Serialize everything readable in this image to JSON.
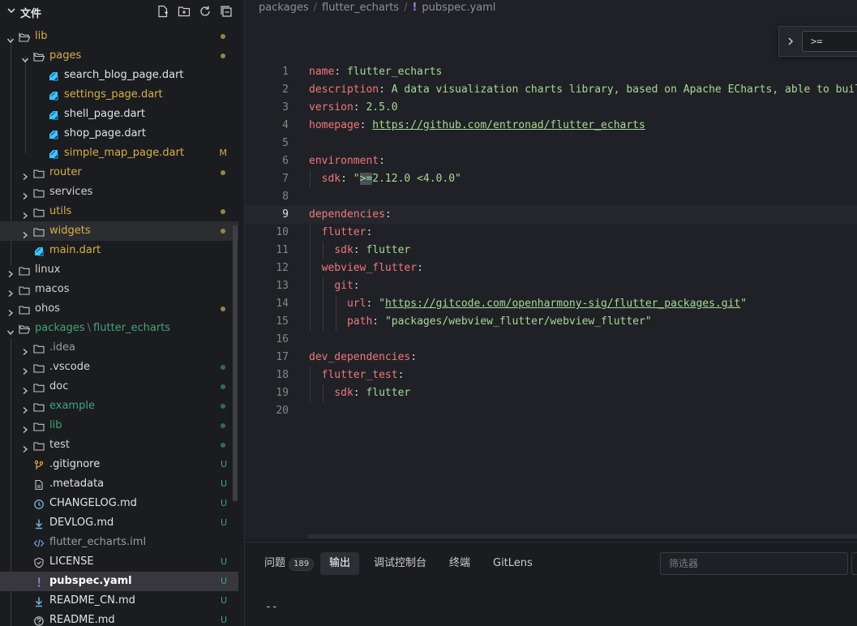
{
  "explorer": {
    "title": "文件",
    "actions": [
      "new-file-icon",
      "new-folder-icon",
      "refresh-icon",
      "collapse-all-icon"
    ],
    "items": [
      {
        "label": "lib",
        "type": "folder",
        "open": true,
        "depth": 0,
        "color": "mod",
        "status": "dot-mod"
      },
      {
        "label": "pages",
        "type": "folder",
        "open": true,
        "depth": 1,
        "color": "mod",
        "status": "dot-mod"
      },
      {
        "label": "search_blog_page.dart",
        "type": "dart",
        "depth": 2,
        "color": "plain",
        "status": ""
      },
      {
        "label": "settings_page.dart",
        "type": "dart",
        "depth": 2,
        "color": "mod",
        "status": ""
      },
      {
        "label": "shell_page.dart",
        "type": "dart",
        "depth": 2,
        "color": "plain",
        "status": ""
      },
      {
        "label": "shop_page.dart",
        "type": "dart",
        "depth": 2,
        "color": "plain",
        "status": ""
      },
      {
        "label": "simple_map_page.dart",
        "type": "dart",
        "depth": 2,
        "color": "mod",
        "status": "M"
      },
      {
        "label": "router",
        "type": "folder",
        "open": false,
        "depth": 1,
        "color": "mod",
        "status": "dot-mod"
      },
      {
        "label": "services",
        "type": "folder",
        "open": false,
        "depth": 1,
        "color": "folder",
        "status": ""
      },
      {
        "label": "utils",
        "type": "folder",
        "open": false,
        "depth": 1,
        "color": "mod",
        "status": "dot-mod"
      },
      {
        "label": "widgets",
        "type": "folder",
        "open": false,
        "depth": 1,
        "color": "mod",
        "status": "dot-mod"
      },
      {
        "label": "main.dart",
        "type": "dart",
        "depth": 1,
        "color": "mod",
        "status": ""
      },
      {
        "label": "linux",
        "type": "folder",
        "open": false,
        "depth": 0,
        "color": "folder",
        "status": ""
      },
      {
        "label": "macos",
        "type": "folder",
        "open": false,
        "depth": 0,
        "color": "folder",
        "status": ""
      },
      {
        "label": "ohos",
        "type": "folder",
        "open": false,
        "depth": 0,
        "color": "folder",
        "status": "dot-mod"
      },
      {
        "label": "packages",
        "label2": "flutter_echarts",
        "type": "folder",
        "open": true,
        "depth": 0,
        "color": "untracked",
        "status": ""
      },
      {
        "label": ".idea",
        "type": "folder",
        "open": false,
        "depth": 1,
        "color": "dim",
        "status": ""
      },
      {
        "label": ".vscode",
        "type": "folder",
        "open": false,
        "depth": 1,
        "color": "folder",
        "status": "dot-untracked"
      },
      {
        "label": "doc",
        "type": "folder",
        "open": false,
        "depth": 1,
        "color": "folder",
        "status": "dot-untracked"
      },
      {
        "label": "example",
        "type": "folder",
        "open": false,
        "depth": 1,
        "color": "untracked",
        "status": "dot-untracked"
      },
      {
        "label": "lib",
        "type": "folder",
        "open": false,
        "depth": 1,
        "color": "untracked",
        "status": "dot-untracked"
      },
      {
        "label": "test",
        "type": "folder",
        "open": false,
        "depth": 1,
        "color": "folder",
        "status": "dot-untracked"
      },
      {
        "label": ".gitignore",
        "type": "git",
        "depth": 1,
        "color": "plain",
        "status": "U"
      },
      {
        "label": ".metadata",
        "type": "file",
        "depth": 1,
        "color": "plain",
        "status": "U"
      },
      {
        "label": "CHANGELOG.md",
        "type": "changelog",
        "depth": 1,
        "color": "plain",
        "status": "U"
      },
      {
        "label": "DEVLOG.md",
        "type": "markdown",
        "depth": 1,
        "color": "plain",
        "status": "U"
      },
      {
        "label": "flutter_echarts.iml",
        "type": "code",
        "depth": 1,
        "color": "dim",
        "status": ""
      },
      {
        "label": "LICENSE",
        "type": "license",
        "depth": 1,
        "color": "plain",
        "status": "U"
      },
      {
        "label": "pubspec.yaml",
        "type": "yaml",
        "depth": 1,
        "color": "plain",
        "status": "U",
        "bold": true
      },
      {
        "label": "README_CN.md",
        "type": "markdown",
        "depth": 1,
        "color": "plain",
        "status": "U"
      },
      {
        "label": "README.md",
        "type": "readme",
        "depth": 1,
        "color": "plain",
        "status": "U"
      }
    ]
  },
  "editor": {
    "breadcrumb": [
      "packages",
      "flutter_echarts",
      "pubspec.yaml"
    ],
    "find_value": ">=",
    "lines": [
      {
        "n": "1",
        "parts": [
          [
            "k",
            "name"
          ],
          [
            "p",
            ": "
          ],
          [
            "s",
            "flutter_echarts"
          ]
        ]
      },
      {
        "n": "2",
        "parts": [
          [
            "k",
            "description"
          ],
          [
            "p",
            ": "
          ],
          [
            "s",
            "A data visualization charts library, based on Apache ECharts, able to buil"
          ]
        ]
      },
      {
        "n": "3",
        "parts": [
          [
            "k",
            "version"
          ],
          [
            "p",
            ": "
          ],
          [
            "s",
            "2.5.0"
          ]
        ]
      },
      {
        "n": "4",
        "parts": [
          [
            "k",
            "homepage"
          ],
          [
            "p",
            ": "
          ],
          [
            "u",
            "https://github.com/entronad/flutter_echarts"
          ]
        ]
      },
      {
        "n": "5",
        "parts": []
      },
      {
        "n": "6",
        "parts": [
          [
            "k",
            "environment"
          ],
          [
            "p",
            ":"
          ]
        ]
      },
      {
        "n": "7",
        "parts": [
          [
            "p",
            "  "
          ],
          [
            "k",
            "sdk"
          ],
          [
            "p",
            ": "
          ],
          [
            "s",
            "\""
          ],
          [
            "hl",
            ">="
          ],
          [
            "s",
            "2.12.0 <4.0.0\""
          ]
        ]
      },
      {
        "n": "8",
        "parts": []
      },
      {
        "n": "9",
        "parts": [
          [
            "k",
            "dependencies"
          ],
          [
            "p",
            ":"
          ]
        ],
        "current": true
      },
      {
        "n": "10",
        "parts": [
          [
            "p",
            "  "
          ],
          [
            "k",
            "flutter"
          ],
          [
            "p",
            ":"
          ]
        ]
      },
      {
        "n": "11",
        "parts": [
          [
            "p",
            "    "
          ],
          [
            "k",
            "sdk"
          ],
          [
            "p",
            ": "
          ],
          [
            "s",
            "flutter"
          ]
        ]
      },
      {
        "n": "12",
        "parts": [
          [
            "p",
            "  "
          ],
          [
            "k",
            "webview_flutter"
          ],
          [
            "p",
            ":"
          ]
        ]
      },
      {
        "n": "13",
        "parts": [
          [
            "p",
            "    "
          ],
          [
            "k",
            "git"
          ],
          [
            "p",
            ":"
          ]
        ]
      },
      {
        "n": "14",
        "parts": [
          [
            "p",
            "      "
          ],
          [
            "k",
            "url"
          ],
          [
            "p",
            ": "
          ],
          [
            "s",
            "\""
          ],
          [
            "u",
            "https://gitcode.com/openharmony-sig/flutter_packages.git"
          ],
          [
            "s",
            "\""
          ]
        ]
      },
      {
        "n": "15",
        "parts": [
          [
            "p",
            "      "
          ],
          [
            "k",
            "path"
          ],
          [
            "p",
            ": "
          ],
          [
            "s",
            "\"packages/webview_flutter/webview_flutter\""
          ]
        ]
      },
      {
        "n": "16",
        "parts": []
      },
      {
        "n": "17",
        "parts": [
          [
            "k",
            "dev_dependencies"
          ],
          [
            "p",
            ":"
          ]
        ]
      },
      {
        "n": "18",
        "parts": [
          [
            "p",
            "  "
          ],
          [
            "k",
            "flutter_test"
          ],
          [
            "p",
            ":"
          ]
        ]
      },
      {
        "n": "19",
        "parts": [
          [
            "p",
            "    "
          ],
          [
            "k",
            "sdk"
          ],
          [
            "p",
            ": "
          ],
          [
            "s",
            "flutter"
          ]
        ]
      },
      {
        "n": "20",
        "parts": []
      }
    ]
  },
  "panel": {
    "tabs": [
      {
        "label": "问题",
        "count": "189"
      },
      {
        "label": "输出",
        "active": true
      },
      {
        "label": "调试控制台"
      },
      {
        "label": "终端"
      },
      {
        "label": "GitLens"
      }
    ],
    "filter_placeholder": "筛选器",
    "output_text": "--"
  },
  "colors": {
    "modified": "#d7b04a",
    "untracked": "#3fa675",
    "key": "#f0787c",
    "string": "#a6da95",
    "background": "#1b1c20"
  }
}
